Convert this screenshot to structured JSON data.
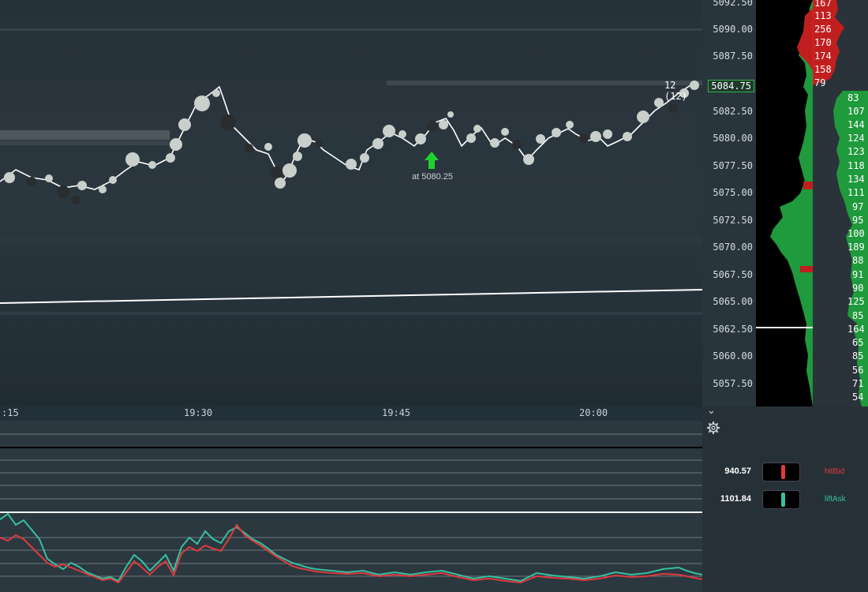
{
  "price_axis": {
    "ticks": [
      "5092.50",
      "5090.00",
      "5087.50",
      "5084.75",
      "5082.50",
      "5080.00",
      "5077.50",
      "5075.00",
      "5072.50",
      "5070.00",
      "5067.50",
      "5065.00",
      "5062.50",
      "5060.00",
      "5057.50"
    ],
    "current_price": "5084.75"
  },
  "time_axis": {
    "labels": [
      ":15",
      "19:30",
      "19:45",
      "20:00"
    ]
  },
  "trade_marker": {
    "label": "at 5080.25"
  },
  "size_label": "12 (12)",
  "dom": {
    "ask_numbers": [
      "167",
      "113",
      "256",
      "170",
      "174",
      "158",
      "79"
    ],
    "bid_numbers": [
      "83",
      "107",
      "144",
      "124",
      "123",
      "118",
      "134",
      "111",
      "97",
      "95",
      "100",
      "189",
      "88",
      "91",
      "90",
      "125",
      "85",
      "164",
      "65",
      "85",
      "56",
      "71",
      "54"
    ]
  },
  "indicator_panel": {
    "rows": [
      {
        "value": "940.57",
        "label": "hitBid",
        "color": "#e0393e"
      },
      {
        "value": "1101.84",
        "label": "liftAsk",
        "color": "#35c0a0"
      }
    ]
  },
  "colors": {
    "ask": "#c11f1f",
    "bid": "#1f9a3c",
    "buy_marker": "#1fd12f",
    "hitBid": "#e0393e",
    "liftAsk": "#35c0a0"
  },
  "icons": {
    "collapse": "chevron-down-icon",
    "settings": "gear-icon"
  }
}
